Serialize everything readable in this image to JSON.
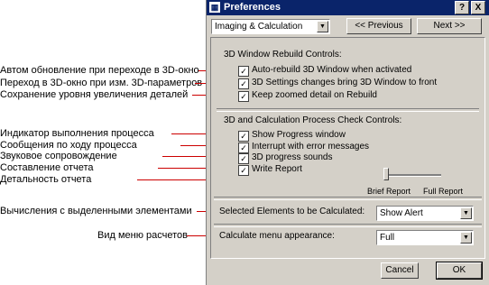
{
  "annotations": [
    {
      "text": "Автом обновление при переходе в 3D-окно"
    },
    {
      "text": "Переход в 3D-окно при изм. 3D-параметров"
    },
    {
      "text": "Сохранение уровня увеличения деталей"
    },
    {
      "text": "Индикатор выполнения процесса"
    },
    {
      "text": "Сообщения по ходу процесса"
    },
    {
      "text": "Звуковое сопровождение"
    },
    {
      "text": "Составление отчета"
    },
    {
      "text": "Детальность отчета"
    },
    {
      "text": "Вычисления с выделенными элементами"
    },
    {
      "text": "Вид меню расчетов"
    }
  ],
  "window": {
    "title": "Preferences",
    "help_btn": "?",
    "close_btn": "X"
  },
  "nav": {
    "page_select": "Imaging & Calculation",
    "prev_label": "<< Previous",
    "next_label": "Next >>"
  },
  "group1": {
    "title": "3D Window Rebuild Controls:",
    "items": [
      {
        "label": "Auto-rebuild 3D Window when activated",
        "checked": true
      },
      {
        "label": "3D Settings changes bring 3D Window to front",
        "checked": true
      },
      {
        "label": "Keep zoomed detail on Rebuild",
        "checked": true
      }
    ]
  },
  "group2": {
    "title": "3D and Calculation Process Check Controls:",
    "items": [
      {
        "label": "Show Progress window",
        "checked": true
      },
      {
        "label": "Interrupt with error messages",
        "checked": true
      },
      {
        "label": "3D progress sounds",
        "checked": true
      },
      {
        "label": "Write Report",
        "checked": true
      }
    ],
    "slider_min_label": "Brief Report",
    "slider_max_label": "Full Report",
    "slider_level": 0
  },
  "selected_elements": {
    "label": "Selected Elements to be Calculated:",
    "value": "Show Alert"
  },
  "calc_menu": {
    "label": "Calculate menu appearance:",
    "value": "Full"
  },
  "footer": {
    "cancel_label": "Cancel",
    "ok_label": "OK"
  },
  "colors": {
    "annotation_arrow": "#cc0000",
    "titlebar": "#0a246a",
    "dialog_bg": "#d4d0c8"
  }
}
